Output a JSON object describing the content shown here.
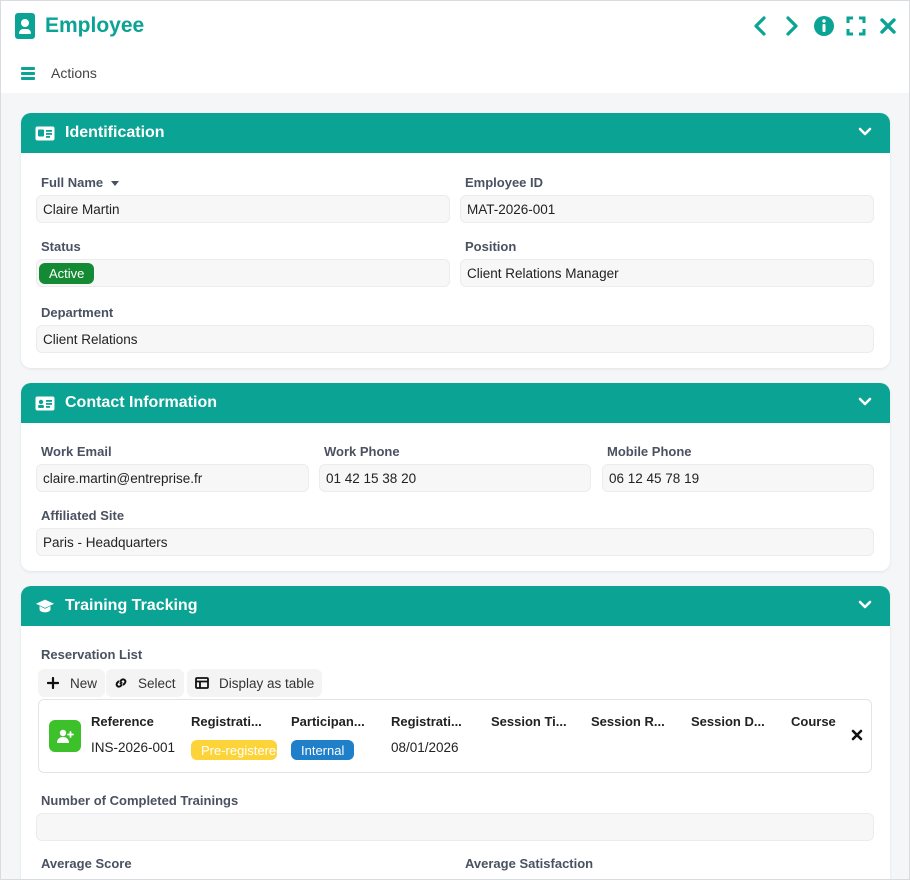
{
  "window": {
    "title": "Employee",
    "actions_label": "Actions",
    "accent": "#0aa394"
  },
  "identification": {
    "title": "Identification",
    "full_name_label": "Full Name",
    "full_name_value": "Claire Martin",
    "employee_id_label": "Employee ID",
    "employee_id_value": "MAT-2026-001",
    "status_label": "Status",
    "status_value": "Active",
    "position_label": "Position",
    "position_value": "Client Relations Manager",
    "department_label": "Department",
    "department_value": "Client Relations"
  },
  "contact": {
    "title": "Contact Information",
    "work_email_label": "Work Email",
    "work_email_value": "claire.martin@entreprise.fr",
    "work_phone_label": "Work Phone",
    "work_phone_value": "01 42 15 38 20",
    "mobile_phone_label": "Mobile Phone",
    "mobile_phone_value": "06 12 45 78 19",
    "site_label": "Affiliated Site",
    "site_value": "Paris - Headquarters"
  },
  "training": {
    "title": "Training Tracking",
    "reservation_list_label": "Reservation List",
    "toolbar": {
      "new_label": "New",
      "select_label": "Select",
      "display_label": "Display as table"
    },
    "columns": [
      "Reference",
      "Registrati...",
      "Participan...",
      "Registrati...",
      "Session Ti...",
      "Session R...",
      "Session D...",
      "Course"
    ],
    "row": {
      "reference": "INS-2026-001",
      "registration_status": "Pre-registered",
      "participant_type": "Internal",
      "registration_date": "08/01/2026"
    },
    "completed_label": "Number of Completed Trainings",
    "completed_value": "",
    "avg_score_label": "Average Score",
    "avg_satisfaction_label": "Average Satisfaction"
  }
}
